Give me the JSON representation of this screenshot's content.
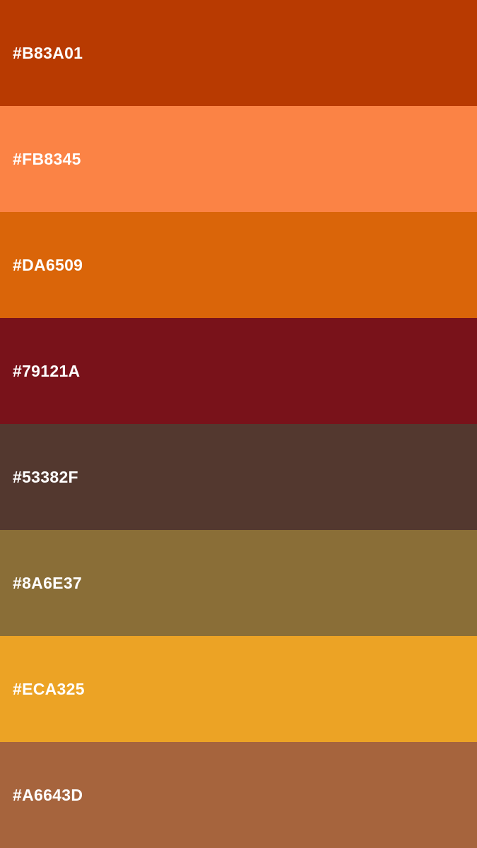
{
  "swatches": [
    {
      "label": "#B83A01",
      "color": "#B83A01"
    },
    {
      "label": "#FB8345",
      "color": "#FB8345"
    },
    {
      "label": "#DA6509",
      "color": "#DA6509"
    },
    {
      "label": "#79121A",
      "color": "#79121A"
    },
    {
      "label": "#53382F",
      "color": "#53382F"
    },
    {
      "label": "#8A6E37",
      "color": "#8A6E37"
    },
    {
      "label": "#ECA325",
      "color": "#ECA325"
    },
    {
      "label": "#A6643D",
      "color": "#A6643D"
    }
  ]
}
